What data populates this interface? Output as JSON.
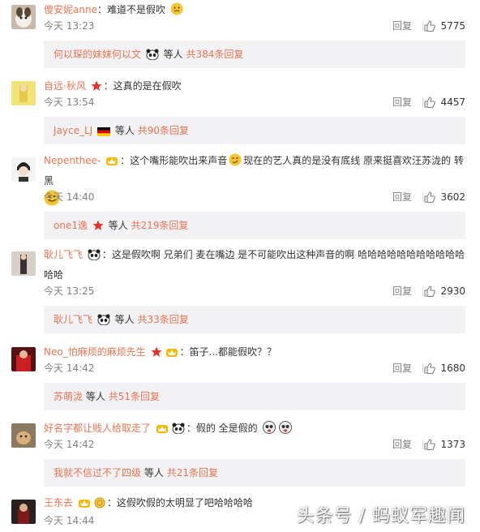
{
  "colors": {
    "accent": "#eb7350",
    "meta": "#808080",
    "sub_bg": "#f2f2f5"
  },
  "labels": {
    "reply": "回复",
    "etc": "等人"
  },
  "comments": [
    {
      "user": "傻安妮anne",
      "sep": "：",
      "text": "难道不是假吹",
      "time": "今天 13:23",
      "likes": "5775",
      "sub_user": "何以琛的妹妹何以文",
      "sub_count": "共384条回复"
    },
    {
      "user": "自远·秋风",
      "sep": "：",
      "text": "这真的是在假吹",
      "time": "今天 13:54",
      "likes": "4457",
      "sub_user": "Jayce_LJ",
      "sub_count": "共90条回复"
    },
    {
      "user": "Nepenthee-",
      "sep": "：",
      "text": "这个嘴形能吹出来声音",
      "text2": "现在的艺人真的是没有底线 原来挺喜欢汪苏泷的 转黑",
      "time": "今天 14:40",
      "likes": "3602",
      "sub_user": "one1逸",
      "sub_count": "共219条回复"
    },
    {
      "user": "耿儿飞飞",
      "sep": "：",
      "text": "这是假吹啊 兄弟们 麦在嘴边 是不可能吹出这种声音的啊 哈哈哈哈哈哈哈哈哈哈哈哈哈",
      "time": "今天 13:25",
      "likes": "2930",
      "sub_user": "耿儿飞飞",
      "sub_count": "共33条回复"
    },
    {
      "user": "Neo_怕麻烦的麻烦先生",
      "sep": "：",
      "text": "笛子...都能假吹？？",
      "time": "今天 14:42",
      "likes": "1680",
      "sub_user": "苏萌泷",
      "sub_count": "共51条回复"
    },
    {
      "user": "好名字都让贱人给取走了",
      "sep": "：",
      "text": "假的 全是假的",
      "time": "今天 14:42",
      "likes": "1373",
      "sub_user": "我就不信过不了四级",
      "sub_count": "共21条回复"
    },
    {
      "user": "王东去",
      "sep": "：",
      "text": "这假吹假的太明显了吧哈哈哈哈",
      "time": "今天 14:44"
    }
  ],
  "watermark": "头条号 / 蚂蚁军趣闻"
}
